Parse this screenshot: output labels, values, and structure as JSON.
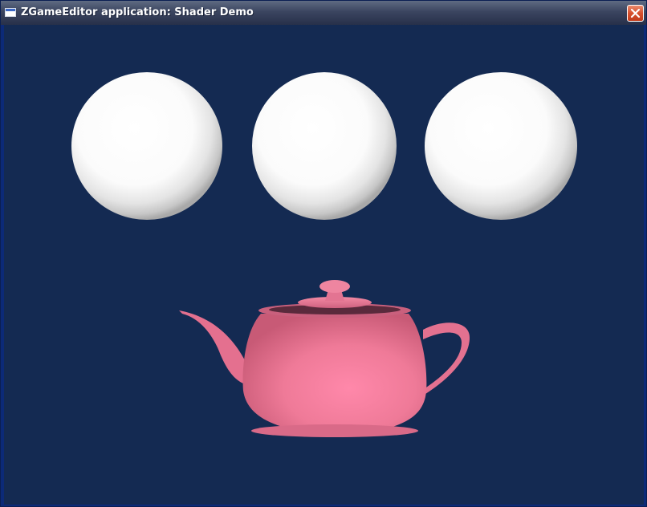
{
  "window": {
    "title": "ZGameEditor application: Shader Demo",
    "icon": "window-icon",
    "close_icon": "close-icon"
  },
  "scene": {
    "background_color": "#142a52",
    "spheres": [
      {
        "name": "sphere-left",
        "color": "#ffffff"
      },
      {
        "name": "sphere-middle",
        "color": "#ffffff"
      },
      {
        "name": "sphere-right",
        "color": "#ffffff"
      }
    ],
    "teapot": {
      "color": "#f07a98"
    }
  }
}
